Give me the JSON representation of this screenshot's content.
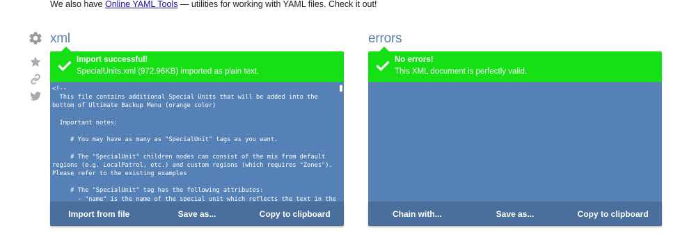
{
  "intro": {
    "prefix": "We also have ",
    "link_text": "Online YAML Tools",
    "suffix": " — utilities for working with YAML files. Check it out!"
  },
  "side_icons": [
    "gear-icon",
    "star-icon",
    "link-icon",
    "twitter-icon"
  ],
  "colors": {
    "accent": "#5a7fae",
    "success": "#14e014",
    "panel_bg": "#5681b6",
    "footer_bg": "#4a6f9c"
  },
  "xml_panel": {
    "title": "xml",
    "banner": {
      "title": "Import successful!",
      "message": "SpecialUnits.xml (972.96KB) imported as plain text."
    },
    "code_text": "<!--\n  This file contains additional Special Units that will be added into the\nbottom of Ultimate Backup Menu (orange color)\n\n  Important notes:\n\n     # You may have as many as \"SpecialUnit\" tags as you want.\n\n     # The \"SpecialUnit\" children nodes can consist of the mix from default\nregions (e.g. LocalPatrol, etc.) and custom regions (which requires \"Zones\").\nPlease refer to the existing examples\n\n     # The \"SpecialUnit\" tag has the following attributes:\n       - \"name\" is the name of the special unit which reflects the text in the\nmenu entry (mandatory)\n       - \"role\" is the role (AI) of that this special unit will play. Valid",
    "buttons": {
      "import": "Import from file",
      "save": "Save as...",
      "copy": "Copy to clipboard"
    }
  },
  "errors_panel": {
    "title": "errors",
    "banner": {
      "title": "No errors!",
      "message": "This XML document is perfectly valid."
    },
    "buttons": {
      "chain": "Chain with...",
      "save": "Save as...",
      "copy": "Copy to clipboard"
    }
  }
}
